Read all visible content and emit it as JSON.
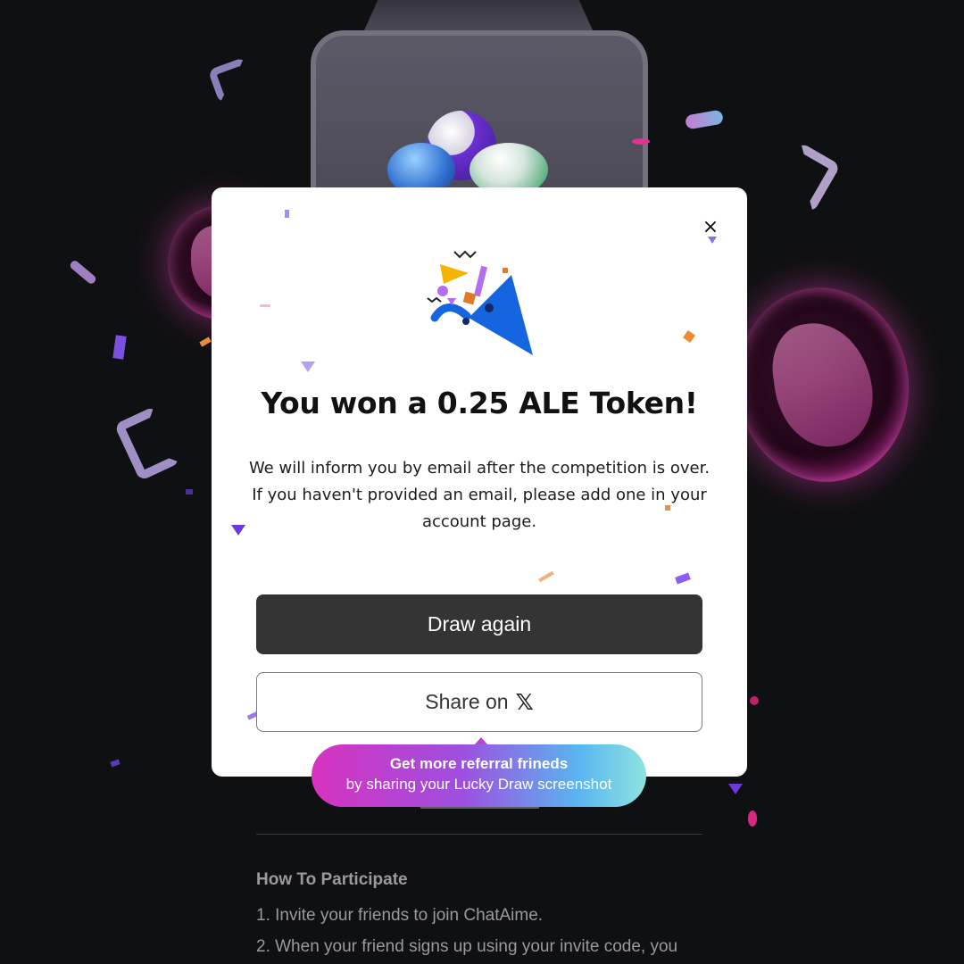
{
  "modal": {
    "close_label": "×",
    "title": "You won a 0.25 ALE Token!",
    "body_line1": "We will inform you by email after the competition is over.",
    "body_line2": "If you haven't provided an email, please add one in your",
    "body_line3": "account page.",
    "draw_again_label": "Draw again",
    "share_label": "Share on",
    "share_icon": "x-logo-icon",
    "share_icon_glyph": "𝕏"
  },
  "tooltip": {
    "line1": "Get more referral frineds",
    "line2": "by sharing your Lucky Draw screenshot"
  },
  "background_page": {
    "heading": "How To Participate",
    "steps": [
      "1. Invite your friends to join ChatAime.",
      "2. When your friend signs up using your invite code, you"
    ]
  },
  "colors": {
    "page_bg": "#0f1012",
    "modal_bg": "#ffffff",
    "primary_button": "#343434",
    "tooltip_gradient_start": "#d633be",
    "tooltip_gradient_end": "#8fe3e0",
    "party_icon_blue": "#1565e0",
    "party_icon_yellow": "#f4b400",
    "party_icon_purple": "#b36ef0"
  }
}
